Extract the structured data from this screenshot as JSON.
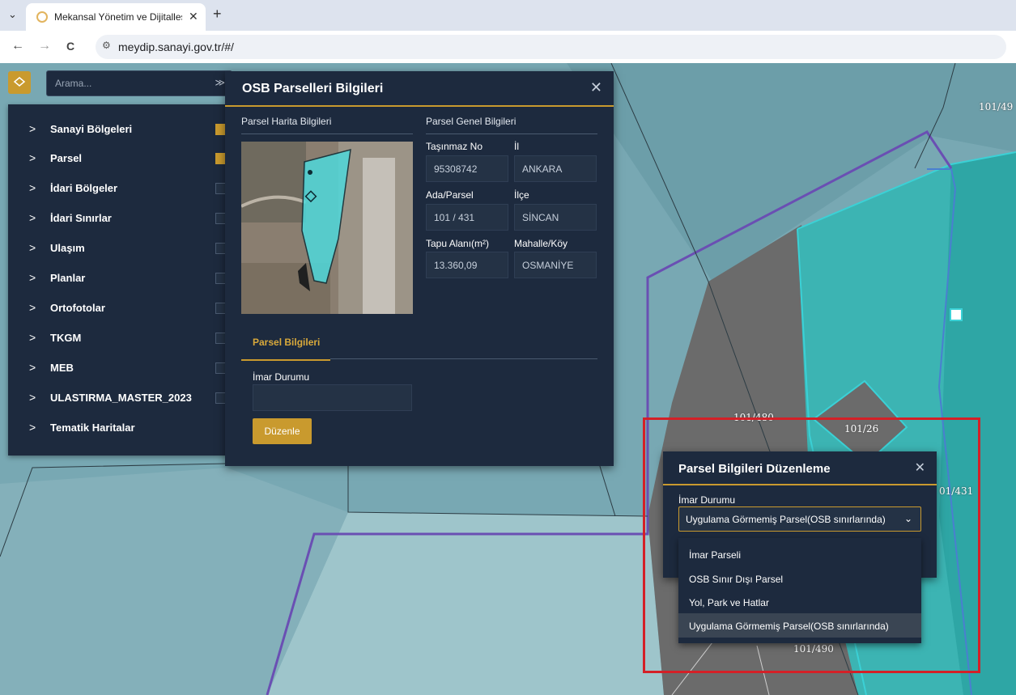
{
  "browser": {
    "tab_title": "Mekansal Yönetim ve Dijitalleşt",
    "tab_close": "✕",
    "new_tab": "+",
    "menu_glyph": "⌄",
    "back": "←",
    "forward": "→",
    "reload": "C",
    "site_icon": "⚙",
    "url": "meydip.sanayi.gov.tr/#/"
  },
  "search": {
    "placeholder": "Arama...",
    "toggle_glyph": "≫"
  },
  "layers": [
    {
      "label": "Sanayi Bölgeleri",
      "checked": true
    },
    {
      "label": "Parsel",
      "checked": true
    },
    {
      "label": "İdari Bölgeler",
      "checked": false
    },
    {
      "label": "İdari Sınırlar",
      "checked": false
    },
    {
      "label": "Ulaşım",
      "checked": false
    },
    {
      "label": "Planlar",
      "checked": false
    },
    {
      "label": "Ortofotolar",
      "checked": false
    },
    {
      "label": "TKGM",
      "checked": false
    },
    {
      "label": "MEB",
      "checked": false
    },
    {
      "label": "ULASTIRMA_MASTER_2023",
      "checked": false
    },
    {
      "label": "Tematik Haritalar",
      "checked": false
    }
  ],
  "info_dialog": {
    "title": "OSB Parselleri Bilgileri",
    "close": "✕",
    "map_section": "Parsel Harita Bilgileri",
    "general_section": "Parsel Genel Bilgileri",
    "fields": {
      "tasinmaz_label": "Taşınmaz No",
      "tasinmaz_value": "95308742",
      "il_label": "İl",
      "il_value": "ANKARA",
      "ada_label": "Ada/Parsel",
      "ada_value": "101 / 431",
      "ilce_label": "İlçe",
      "ilce_value": "SİNCAN",
      "tapu_label": "Tapu Alanı(m²)",
      "tapu_value": "13.360,09",
      "mahalle_label": "Mahalle/Köy",
      "mahalle_value": "OSMANİYE"
    },
    "tab_label": "Parsel Bilgileri",
    "imar_label": "İmar Durumu",
    "imar_value": "",
    "edit_button": "Düzenle"
  },
  "edit_dialog": {
    "title": "Parsel Bilgileri Düzenleme",
    "close": "✕",
    "imar_label": "İmar Durumu",
    "selected": "Uygulama Görmemiş Parsel(OSB sınırlarında)",
    "chevron": "⌄",
    "options": [
      "İmar Parseli",
      "OSB Sınır Dışı Parsel",
      "Yol, Park ve Hatlar",
      "Uygulama Görmemiş Parsel(OSB sınırlarında)"
    ],
    "selected_index": 3
  },
  "map_labels": {
    "l1": "101/49",
    "l2": "101/480",
    "l3": "101/26",
    "l4": "01/431",
    "l5": "101/490"
  },
  "colors": {
    "panel_bg": "#1d2a3e",
    "accent": "#c99a2e",
    "highlight": "#d42027",
    "parcel_cyan": "#3bd1d6",
    "boundary_purple": "#6a4fb3"
  }
}
